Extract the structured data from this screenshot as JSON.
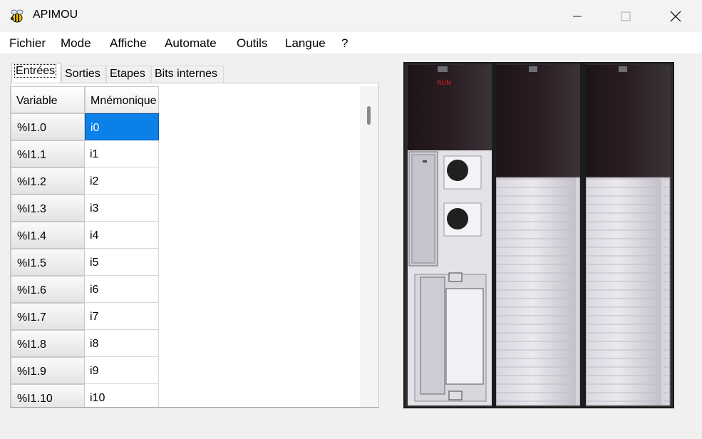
{
  "window": {
    "title": "APIMOU",
    "icon": "bee-icon",
    "controls": [
      "minimize-icon",
      "maximize-icon",
      "close-icon"
    ]
  },
  "menu": [
    "Fichier",
    "Mode",
    "Affiche",
    "Automate",
    "Outils",
    "Langue",
    "?"
  ],
  "tabs": [
    {
      "label": "Entrées",
      "active": true
    },
    {
      "label": "Sorties",
      "active": false
    },
    {
      "label": "Etapes",
      "active": false
    },
    {
      "label": "Bits internes",
      "active": false
    }
  ],
  "table": {
    "columns": [
      "Variable",
      "Mnémonique"
    ],
    "rows": [
      {
        "variable": "%I1.0",
        "mnemonic": "i0",
        "selected": true
      },
      {
        "variable": "%I1.1",
        "mnemonic": "i1"
      },
      {
        "variable": "%I1.2",
        "mnemonic": "i2"
      },
      {
        "variable": "%I1.3",
        "mnemonic": "i3"
      },
      {
        "variable": "%I1.4",
        "mnemonic": "i4"
      },
      {
        "variable": "%I1.5",
        "mnemonic": "i5"
      },
      {
        "variable": "%I1.6",
        "mnemonic": "i6"
      },
      {
        "variable": "%I1.7",
        "mnemonic": "i7"
      },
      {
        "variable": "%I1.8",
        "mnemonic": "i8"
      },
      {
        "variable": "%I1.9",
        "mnemonic": "i9"
      },
      {
        "variable": "%I1.10",
        "mnemonic": "i10"
      }
    ]
  },
  "plc": {
    "run_label": "RUN",
    "run_color": "#e02020",
    "accent_selection": "#0a80e8"
  }
}
